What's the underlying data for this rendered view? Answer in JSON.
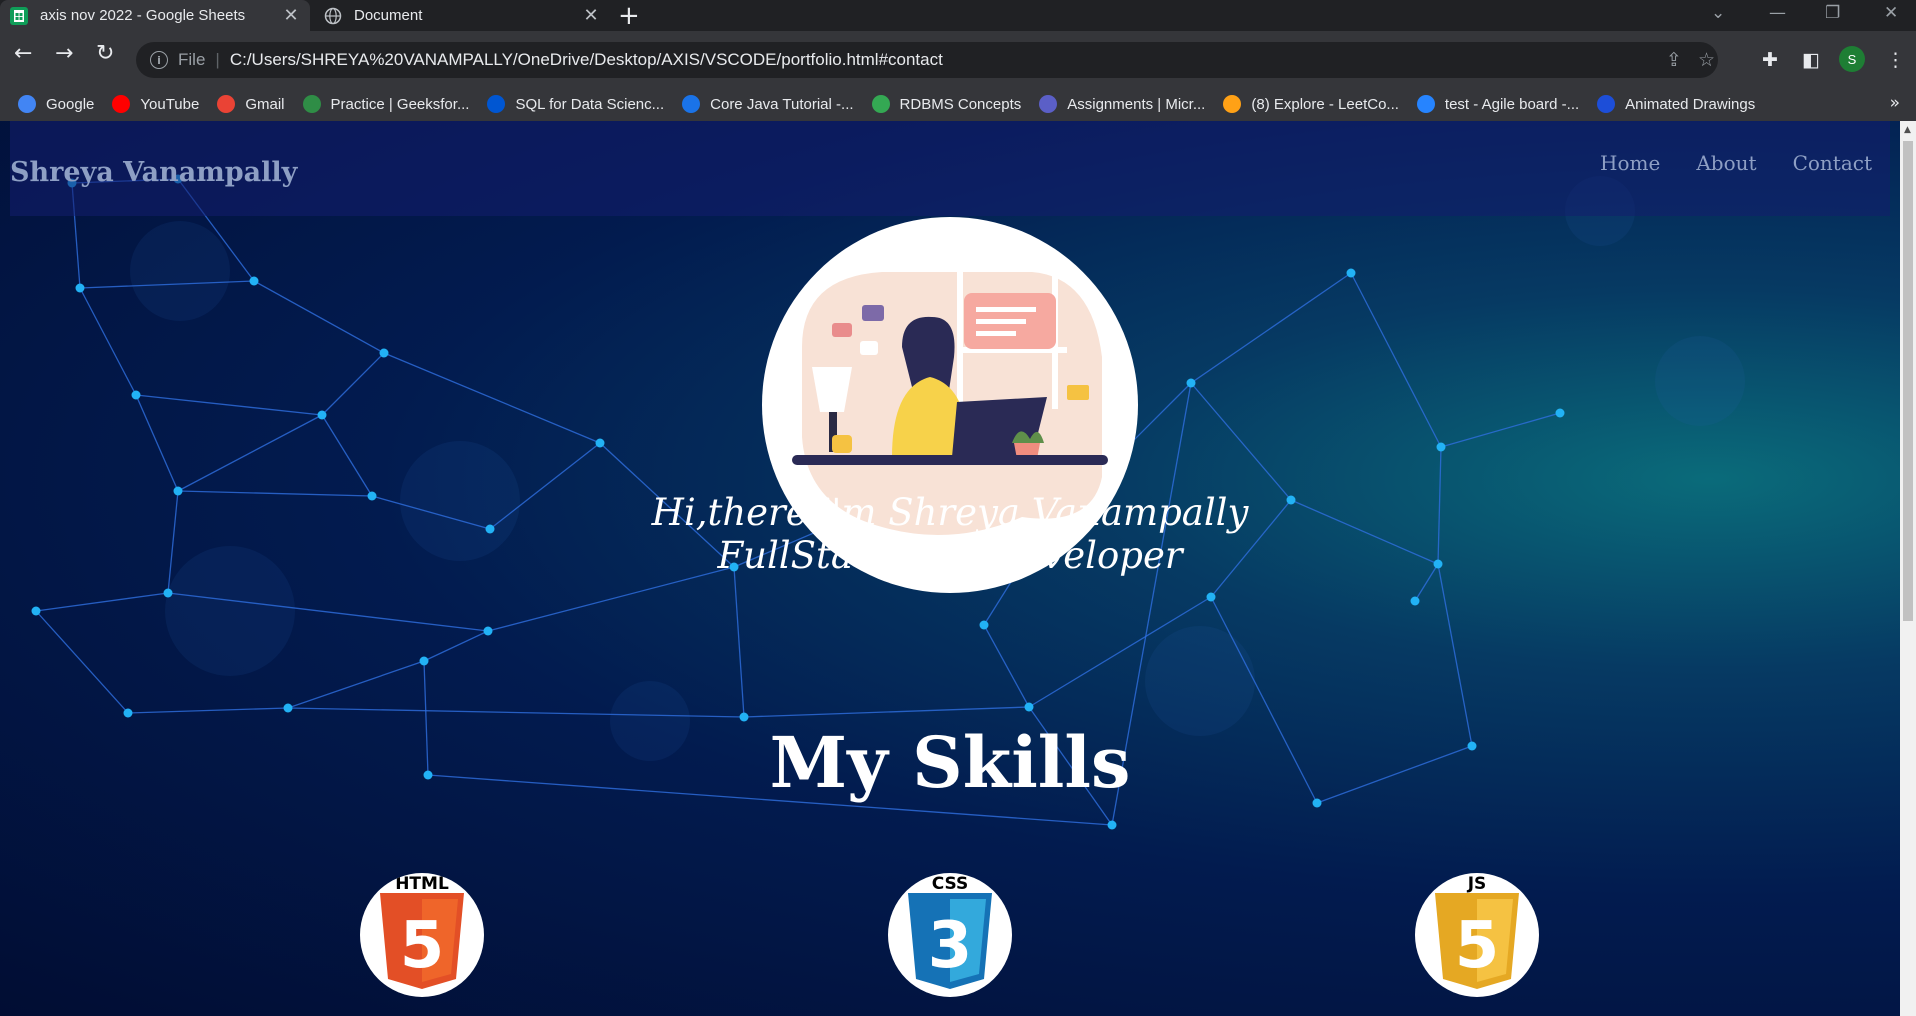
{
  "browser": {
    "tabs": [
      {
        "title": "axis nov 2022 - Google Sheets",
        "active": true
      },
      {
        "title": "Document",
        "active": false
      }
    ],
    "address": {
      "scheme_label": "File",
      "url": "C:/Users/SHREYA%20VANAMPALLY/OneDrive/Desktop/AXIS/VSCODE/portfolio.html#contact"
    },
    "profile_initial": "S",
    "bookmarks": [
      {
        "label": "Google",
        "icon": "google-icon",
        "color": "#4285f4"
      },
      {
        "label": "YouTube",
        "icon": "youtube-icon",
        "color": "#ff0000"
      },
      {
        "label": "Gmail",
        "icon": "gmail-icon",
        "color": "#ea4335"
      },
      {
        "label": "Practice | Geeksfor...",
        "icon": "geeksforgeeks-icon",
        "color": "#2f8d46"
      },
      {
        "label": "SQL for Data Scienc...",
        "icon": "coursera-icon",
        "color": "#0056d2"
      },
      {
        "label": "Core Java Tutorial -...",
        "icon": "core-java-icon",
        "color": "#1a73e8"
      },
      {
        "label": "RDBMS Concepts",
        "icon": "rdbms-icon",
        "color": "#34a853"
      },
      {
        "label": "Assignments | Micr...",
        "icon": "teams-icon",
        "color": "#5b5fc7"
      },
      {
        "label": "(8) Explore - LeetCo...",
        "icon": "leetcode-icon",
        "color": "#ffa116"
      },
      {
        "label": "test - Agile board -...",
        "icon": "jira-icon",
        "color": "#2684ff"
      },
      {
        "label": "Animated Drawings",
        "icon": "animated-drawings-icon",
        "color": "#1d4ed8"
      }
    ]
  },
  "site": {
    "brand": "Shreya Vanampally",
    "nav": [
      "Home",
      "About",
      "Contact"
    ],
    "intro_line1": "Hi,there i'm Shreya Vanampally",
    "intro_line2": "FullStack web developer",
    "skills_title": "My Skills",
    "skills": [
      {
        "badge": "HTML",
        "number": "5",
        "color": "#e34f26",
        "icon": "html5-icon"
      },
      {
        "badge": "CSS",
        "number": "3",
        "color": "#1572b6",
        "icon": "css3-icon"
      },
      {
        "badge": "JS",
        "number": "5",
        "color": "#e5a823",
        "icon": "javascript-icon"
      }
    ]
  }
}
